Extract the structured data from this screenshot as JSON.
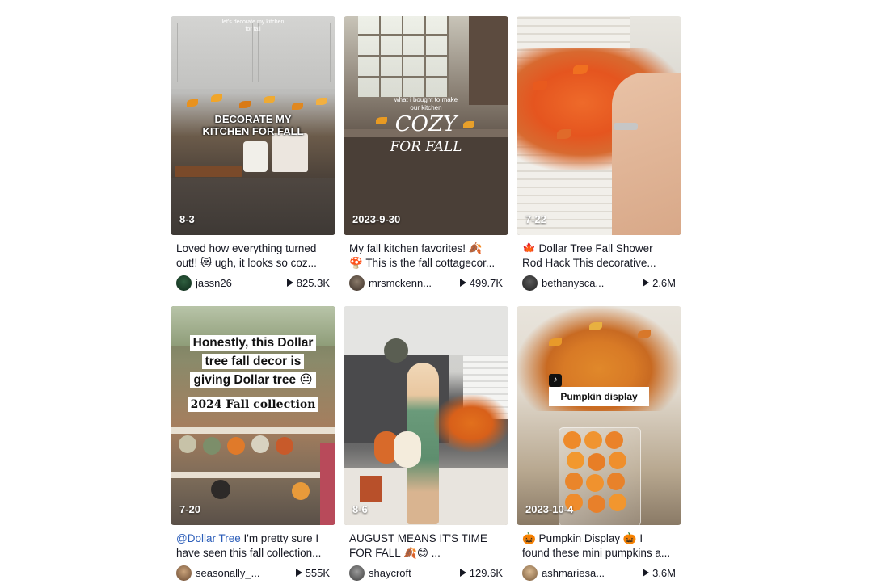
{
  "cards": [
    {
      "overlay_top": "let's decorate my kitchen for fall",
      "overlay_main": "DECORATE MY KITCHEN FOR FALL",
      "date": "8-3",
      "desc_line1": "Loved how everything turned",
      "desc_line2": "out!! 😻 ugh, it looks so coz...",
      "username": "jassn26",
      "views": "825.3K"
    },
    {
      "overlay_top": "what i bought to make our kitchen",
      "overlay_main": "COZY",
      "overlay_sub": "FOR FALL",
      "date": "2023-9-30",
      "desc_line1": "My fall kitchen favorites! 🍂",
      "desc_line2": "🍄 This is the fall cottagecor...",
      "username": "mrsmckenn...",
      "views": "499.7K"
    },
    {
      "date": "7-22",
      "desc_line1": "🍁 Dollar Tree Fall Shower",
      "desc_line2": "Rod Hack This decorative...",
      "username": "bethanysca...",
      "views": "2.6M"
    },
    {
      "overlay_main": "Honestly, this Dollar tree fall decor is giving Dollar tree 😐",
      "overlay_sub": "2024 Fall collection",
      "date": "7-20",
      "desc_mention": "@Dollar Tree",
      "desc_line1": " I'm pretty sure I",
      "desc_line2": "have seen this fall collection...",
      "username": "seasonally_...",
      "views": "555K"
    },
    {
      "date": "8-6",
      "desc_line1": "AUGUST MEANS IT'S TIME",
      "desc_line2": "FOR FALL 🍂😊 ...",
      "username": "shaycroft",
      "views": "129.6K"
    },
    {
      "overlay_main": "Pumpkin display",
      "date": "2023-10-4",
      "desc_line1": "🎃 Pumpkin Display 🎃 I",
      "desc_line2": "found these mini pumpkins a...",
      "username": "ashmariesa...",
      "views": "3.6M"
    }
  ],
  "icons": {
    "views": "play-icon",
    "badge": "tiktok-logo-icon"
  }
}
